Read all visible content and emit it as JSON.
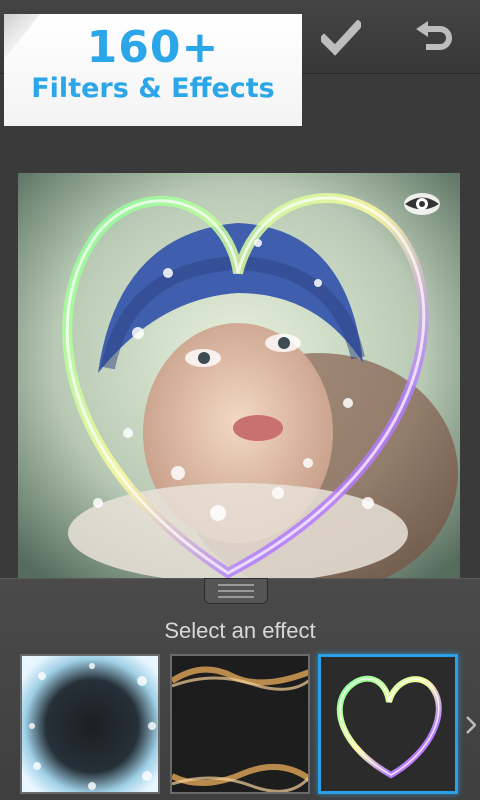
{
  "toolbar": {
    "confirm_icon": "checkmark-icon",
    "undo_icon": "undo-arrow-icon"
  },
  "promo": {
    "headline": "160+",
    "subline": "Filters & Effects"
  },
  "preview": {
    "toggle_icon": "eye-icon"
  },
  "effects": {
    "prompt": "Select an effect",
    "thumbnails": [
      {
        "name": "frost-frame",
        "selected": false
      },
      {
        "name": "smoke-frame",
        "selected": false
      },
      {
        "name": "light-heart",
        "selected": true
      }
    ],
    "next_icon": "chevron-right-icon"
  },
  "colors": {
    "accent": "#2aa6e9",
    "selection": "#2aa0e8",
    "background": "#3a3a3a"
  }
}
